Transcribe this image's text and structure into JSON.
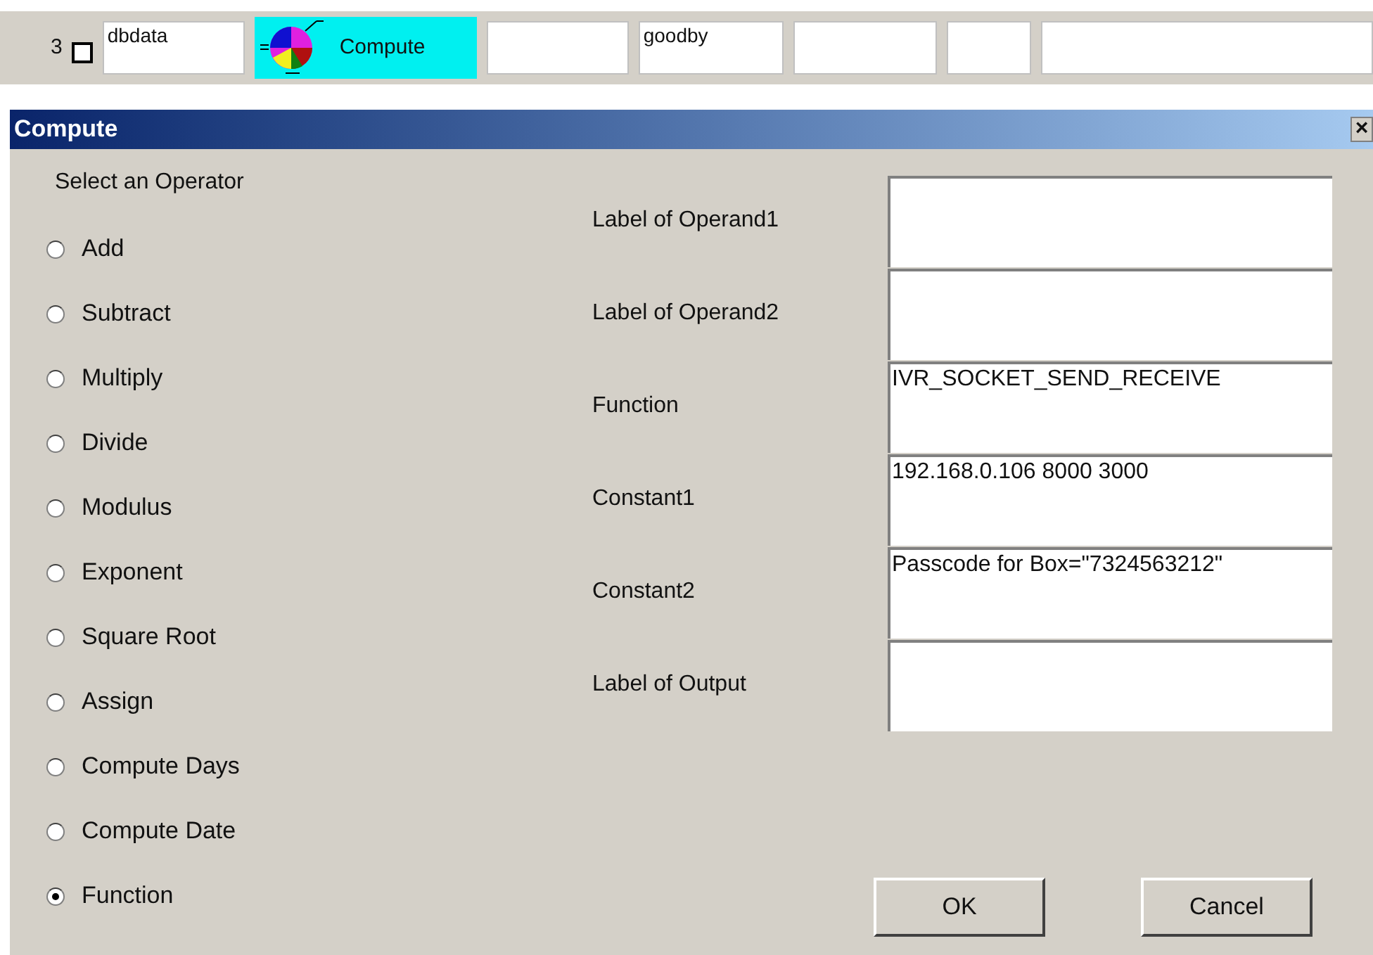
{
  "top_row": {
    "number": "3",
    "checked": false,
    "cells": [
      {
        "kind": "field",
        "value": "dbdata"
      },
      {
        "kind": "node",
        "label": "Compute"
      },
      {
        "kind": "field"
      },
      {
        "kind": "field",
        "value": "goodby"
      },
      {
        "kind": "field"
      },
      {
        "kind": "field"
      },
      {
        "kind": "field"
      }
    ]
  },
  "dialog": {
    "title": "Compute",
    "close": "×",
    "operator_heading": "Select an Operator",
    "operators": [
      {
        "label": "Add",
        "selected": false
      },
      {
        "label": "Subtract",
        "selected": false
      },
      {
        "label": "Multiply",
        "selected": false
      },
      {
        "label": "Divide",
        "selected": false
      },
      {
        "label": "Modulus",
        "selected": false
      },
      {
        "label": "Exponent",
        "selected": false
      },
      {
        "label": "Square Root",
        "selected": false
      },
      {
        "label": "Assign",
        "selected": false
      },
      {
        "label": "Compute Days",
        "selected": false
      },
      {
        "label": "Compute Date",
        "selected": false
      },
      {
        "label": "Function",
        "selected": true
      }
    ],
    "fields": [
      {
        "label": "Label of Operand1"
      },
      {
        "label": "Label of Operand2"
      },
      {
        "label": "Function",
        "value": "IVR_SOCKET_SEND_RECEIVE"
      },
      {
        "label": "Constant1",
        "value": "192.168.0.106 8000 3000"
      },
      {
        "label": "Constant2",
        "value": "Passcode for Box=\"7324563212\""
      },
      {
        "label": "Label of Output"
      }
    ],
    "buttons": [
      "OK",
      "Cancel"
    ]
  }
}
